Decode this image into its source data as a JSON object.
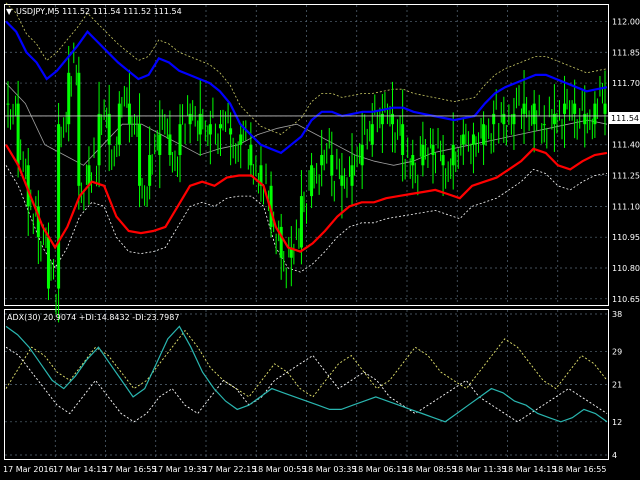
{
  "colors": {
    "background": "#000000",
    "grid": "#596b7a",
    "axis": "#ffffff",
    "bull_candle": "#00ff00",
    "bear_candle": "#00ff00",
    "upper_band": "#0000ff",
    "lower_band": "#ff0000",
    "middle_line": "#a0a0a0",
    "envelope_upper": "#cccc66",
    "envelope_lower": "#ffffff",
    "price_line": "#c0c0c0",
    "price_tag_bg": "#ffffff",
    "adx_line": "#2ab6b0",
    "plus_di": "#e8e870",
    "minus_di": "#ffffff"
  },
  "main_header": {
    "arrow_icon": "triangle-down-icon",
    "text": "USDJPY,M5  111.52 111.54 111.52 111.54"
  },
  "current_price": "111.54",
  "chart_data": [
    {
      "type": "candlestick",
      "title": "USDJPY,M5",
      "ylim": [
        110.62,
        112.08
      ],
      "y_ticks": [
        "112.00",
        "111.85",
        "111.70",
        "111.54",
        "111.40",
        "111.25",
        "111.10",
        "110.95",
        "110.80",
        "110.65"
      ],
      "series": [
        {
          "name": "close",
          "values": [
            111.6,
            111.3,
            111.1,
            110.95,
            110.7,
            111.5,
            111.75,
            111.2,
            111.3,
            111.55,
            111.4,
            111.6,
            111.5,
            111.2,
            111.35,
            111.45,
            111.35,
            111.5,
            111.55,
            111.45,
            111.5,
            111.48,
            111.45,
            111.4,
            111.3,
            111.2,
            111.0,
            110.85,
            110.9,
            111.15,
            111.3,
            111.35,
            111.25,
            111.2,
            111.3,
            111.4,
            111.5,
            111.55,
            111.5,
            111.35,
            111.3,
            111.4,
            111.35,
            111.3,
            111.4,
            111.45,
            111.4,
            111.5,
            111.55,
            111.5,
            111.55,
            111.6,
            111.5,
            111.5,
            111.55,
            111.6,
            111.55,
            111.5,
            111.6,
            111.55
          ]
        },
        {
          "name": "upper band",
          "values": [
            112.0,
            111.95,
            111.85,
            111.8,
            111.72,
            111.76,
            111.82,
            111.88,
            111.95,
            111.9,
            111.85,
            111.8,
            111.76,
            111.72,
            111.74,
            111.82,
            111.8,
            111.76,
            111.74,
            111.72,
            111.7,
            111.66,
            111.6,
            111.5,
            111.45,
            111.4,
            111.38,
            111.36,
            111.4,
            111.44,
            111.52,
            111.56,
            111.56,
            111.54,
            111.55,
            111.56,
            111.56,
            111.57,
            111.58,
            111.58,
            111.56,
            111.55,
            111.54,
            111.53,
            111.52,
            111.53,
            111.54,
            111.6,
            111.65,
            111.68,
            111.7,
            111.72,
            111.74,
            111.74,
            111.72,
            111.7,
            111.68,
            111.66,
            111.67,
            111.68
          ]
        },
        {
          "name": "lower band",
          "values": [
            111.4,
            111.3,
            111.15,
            111.0,
            110.9,
            111.0,
            111.15,
            111.22,
            111.2,
            111.05,
            110.98,
            110.97,
            110.98,
            111.0,
            111.1,
            111.2,
            111.22,
            111.2,
            111.24,
            111.25,
            111.25,
            111.2,
            111.0,
            110.9,
            110.88,
            110.92,
            110.98,
            111.05,
            111.1,
            111.12,
            111.12,
            111.14,
            111.15,
            111.16,
            111.17,
            111.18,
            111.16,
            111.14,
            111.2,
            111.22,
            111.24,
            111.28,
            111.32,
            111.38,
            111.36,
            111.3,
            111.28,
            111.32,
            111.35,
            111.36
          ]
        },
        {
          "name": "middle line",
          "values": [
            111.7,
            111.6,
            111.4,
            111.35,
            111.3,
            111.4,
            111.5,
            111.5,
            111.45,
            111.4,
            111.35,
            111.38,
            111.4,
            111.45,
            111.48,
            111.5,
            111.45,
            111.4,
            111.35,
            111.32,
            111.3,
            111.32,
            111.36,
            111.38,
            111.4,
            111.42,
            111.44,
            111.46,
            111.48,
            111.5,
            111.52,
            111.5
          ]
        }
      ]
    },
    {
      "type": "line",
      "title": "ADX(30) 20.9074 +DI:14.8432 -DI:23.7987",
      "ylim": [
        4,
        38
      ],
      "y_ticks": [
        "38",
        "29",
        "21",
        "12",
        "4"
      ],
      "series": [
        {
          "name": "ADX",
          "values": [
            35,
            33,
            30,
            26,
            22,
            20,
            23,
            27,
            30,
            26,
            22,
            18,
            20,
            26,
            32,
            35,
            30,
            24,
            20,
            17,
            15,
            16,
            18,
            20,
            19,
            18,
            17,
            16,
            15,
            15,
            16,
            17,
            18,
            17,
            16,
            15,
            14,
            13,
            12,
            14,
            16,
            18,
            20,
            19,
            17,
            16,
            14,
            13,
            12,
            13,
            15,
            14,
            12
          ]
        },
        {
          "name": "+DI",
          "values": [
            20,
            25,
            30,
            28,
            24,
            22,
            26,
            30,
            28,
            24,
            20,
            22,
            26,
            30,
            34,
            30,
            25,
            22,
            20,
            18,
            22,
            26,
            24,
            20,
            18,
            22,
            26,
            28,
            24,
            20,
            22,
            26,
            30,
            28,
            24,
            22,
            20,
            24,
            28,
            32,
            30,
            26,
            22,
            20,
            24,
            28,
            26,
            22
          ]
        },
        {
          "name": "-DI",
          "values": [
            30,
            28,
            24,
            20,
            16,
            14,
            18,
            22,
            18,
            14,
            12,
            14,
            18,
            20,
            16,
            14,
            18,
            22,
            20,
            16,
            18,
            22,
            24,
            26,
            28,
            24,
            20,
            22,
            24,
            22,
            18,
            16,
            14,
            16,
            18,
            20,
            22,
            18,
            16,
            14,
            12,
            14,
            16,
            18,
            20,
            18,
            16,
            14
          ]
        }
      ]
    }
  ],
  "adx_header": "ADX(30) 20.9074 +DI:14.8432 -DI:23.7987",
  "time_labels": [
    "17 Mar 2016",
    "17 Mar 14:15",
    "17 Mar 16:55",
    "17 Mar 19:35",
    "17 Mar 22:15",
    "18 Mar 00:55",
    "18 Mar 03:35",
    "18 Mar 06:15",
    "18 Mar 08:55",
    "18 Mar 11:35",
    "18 Mar 14:15",
    "18 Mar 16:55"
  ]
}
